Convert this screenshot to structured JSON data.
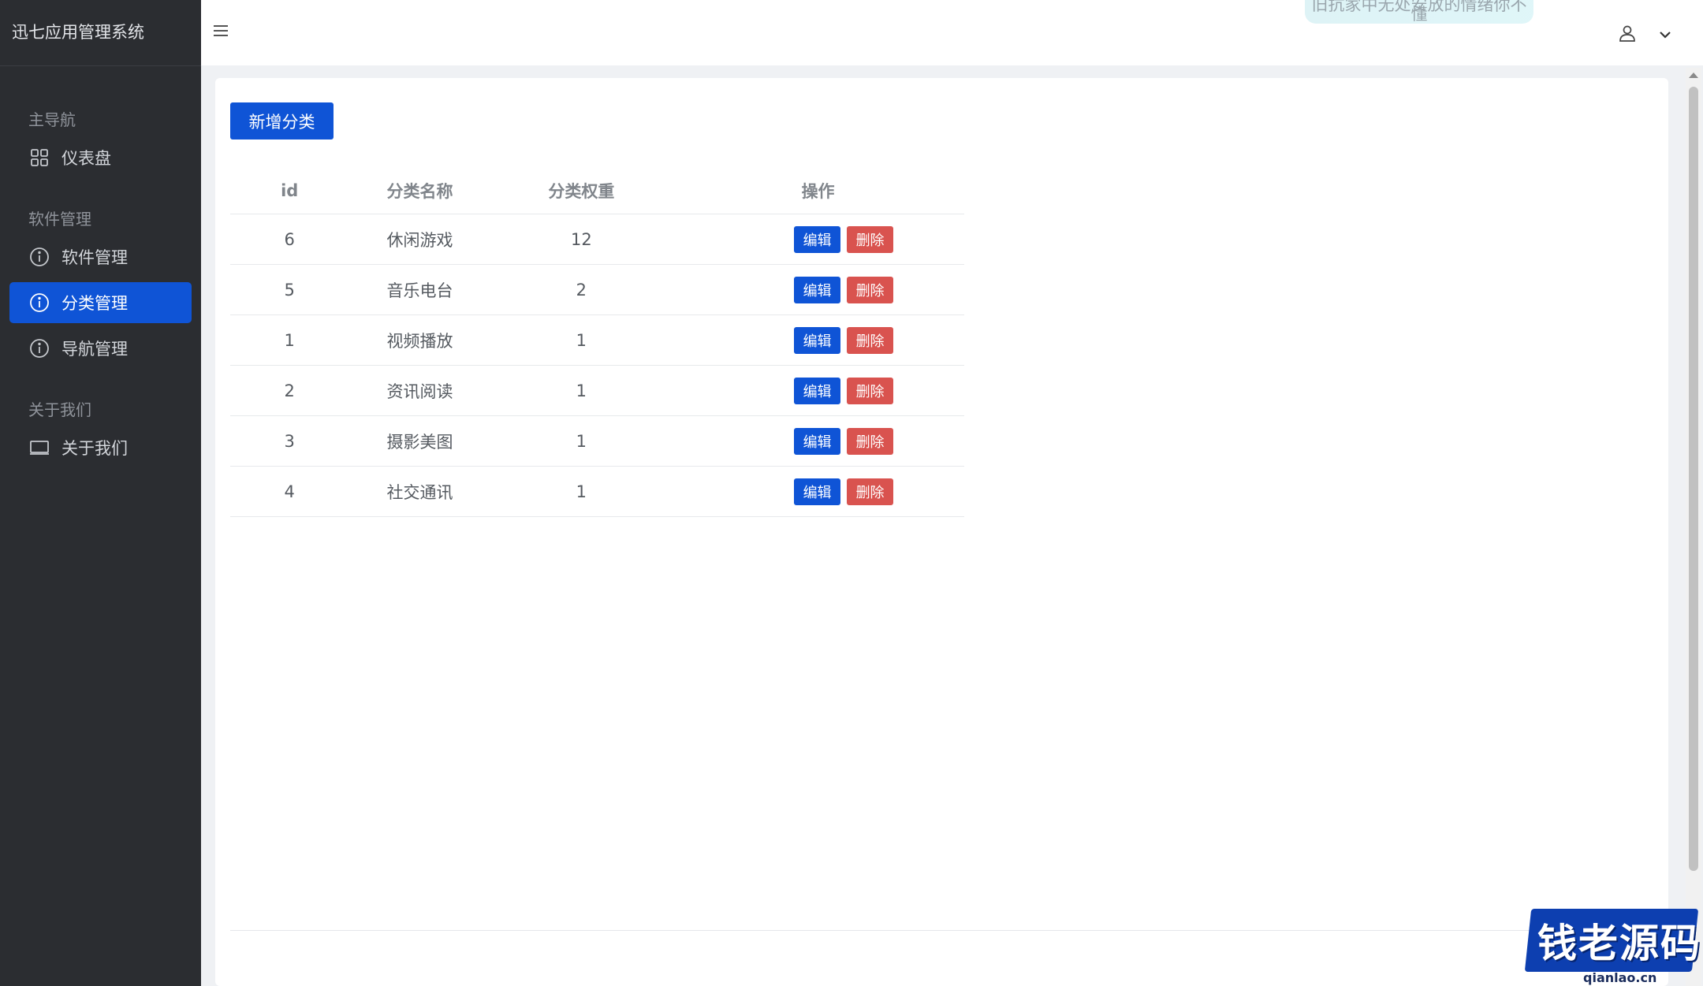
{
  "app": {
    "title": "迅七应用管理系统"
  },
  "sidebar": {
    "groups": [
      {
        "label": "主导航",
        "items": [
          {
            "label": "仪表盘",
            "icon": "grid-icon"
          }
        ]
      },
      {
        "label": "软件管理",
        "items": [
          {
            "label": "软件管理",
            "icon": "info-circle-icon"
          },
          {
            "label": "分类管理",
            "icon": "info-circle-icon",
            "active": true
          },
          {
            "label": "导航管理",
            "icon": "info-circle-icon"
          }
        ]
      },
      {
        "label": "关于我们",
        "items": [
          {
            "label": "关于我们",
            "icon": "monitor-icon"
          }
        ]
      }
    ]
  },
  "topbar": {
    "banner_text": "旧抗家中无处安放的情绪你不懂"
  },
  "content": {
    "add_button": "新增分类",
    "table": {
      "headers": [
        "id",
        "分类名称",
        "分类权重",
        "操作"
      ],
      "edit_label": "编辑",
      "delete_label": "删除",
      "rows": [
        {
          "id": "6",
          "name": "休闲游戏",
          "weight": "12"
        },
        {
          "id": "5",
          "name": "音乐电台",
          "weight": "2"
        },
        {
          "id": "1",
          "name": "视频播放",
          "weight": "1"
        },
        {
          "id": "2",
          "name": "资讯阅读",
          "weight": "1"
        },
        {
          "id": "3",
          "name": "摄影美图",
          "weight": "1"
        },
        {
          "id": "4",
          "name": "社交通讯",
          "weight": "1"
        }
      ]
    }
  },
  "watermark": {
    "logo_text": "钱老源码",
    "url": "qianlao.cn"
  },
  "colors": {
    "primary": "#0f54d6",
    "danger": "#d9534f",
    "sidebar_bg": "#2b2d31"
  }
}
